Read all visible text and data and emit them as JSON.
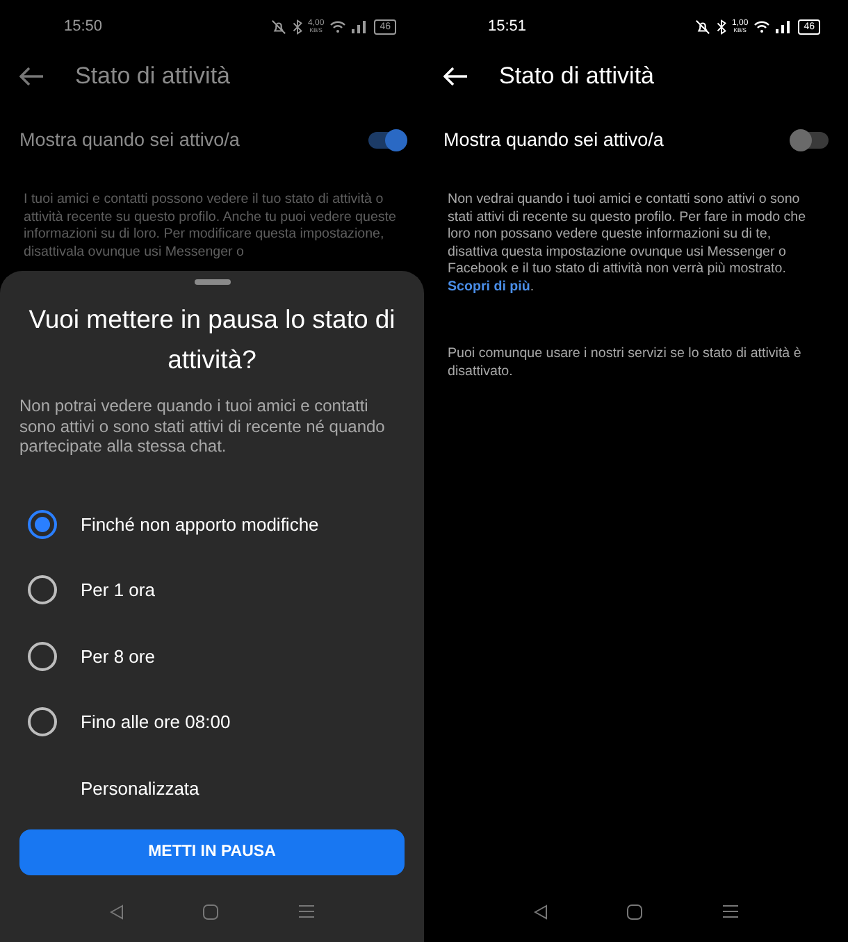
{
  "screens": [
    {
      "status_bar": {
        "time": "15:50",
        "net_speed": "4,00",
        "speed_unit": "KB/S",
        "battery": "46"
      },
      "header": {
        "title": "Stato di attività"
      },
      "toggle": {
        "label": "Mostra quando sei attivo/a",
        "on": true
      },
      "description": "I tuoi amici e contatti possono vedere il tuo stato di attività o attività recente su questo profilo. Anche tu puoi vedere queste informazioni su di loro. Per modificare questa impostazione, disattivala ovunque usi Messenger o",
      "sheet": {
        "title": "Vuoi mettere in pausa lo stato di attività?",
        "text": "Non potrai vedere quando i tuoi amici e contatti sono attivi o sono stati attivi di recente né quando partecipate alla stessa chat.",
        "options": [
          {
            "kind": "radio",
            "label": "Finché non apporto modifiche",
            "selected": true
          },
          {
            "kind": "radio",
            "label": "Per 1 ora",
            "selected": false
          },
          {
            "kind": "radio",
            "label": "Per 8 ore",
            "selected": false
          },
          {
            "kind": "radio",
            "label": "Fino alle ore 08:00",
            "selected": false
          },
          {
            "kind": "plain",
            "label": "Personalizzata"
          }
        ],
        "button": "METTI IN PAUSA"
      }
    },
    {
      "status_bar": {
        "time": "15:51",
        "net_speed": "1,00",
        "speed_unit": "KB/S",
        "battery": "46"
      },
      "header": {
        "title": "Stato di attività"
      },
      "toggle": {
        "label": "Mostra quando sei attivo/a",
        "on": false
      },
      "description": "Non vedrai quando i tuoi amici e contatti sono attivi o sono stati attivi di recente su questo profilo. Per fare in modo che loro non possano vedere queste informazioni su di te, disattiva questa impostazione ovunque usi Messenger o Facebook e il tuo stato di attività non verrà più mostrato.",
      "link": "Scopri di più",
      "link_suffix": ".",
      "note": "Puoi comunque usare i nostri servizi se lo stato di attività è disattivato."
    }
  ]
}
